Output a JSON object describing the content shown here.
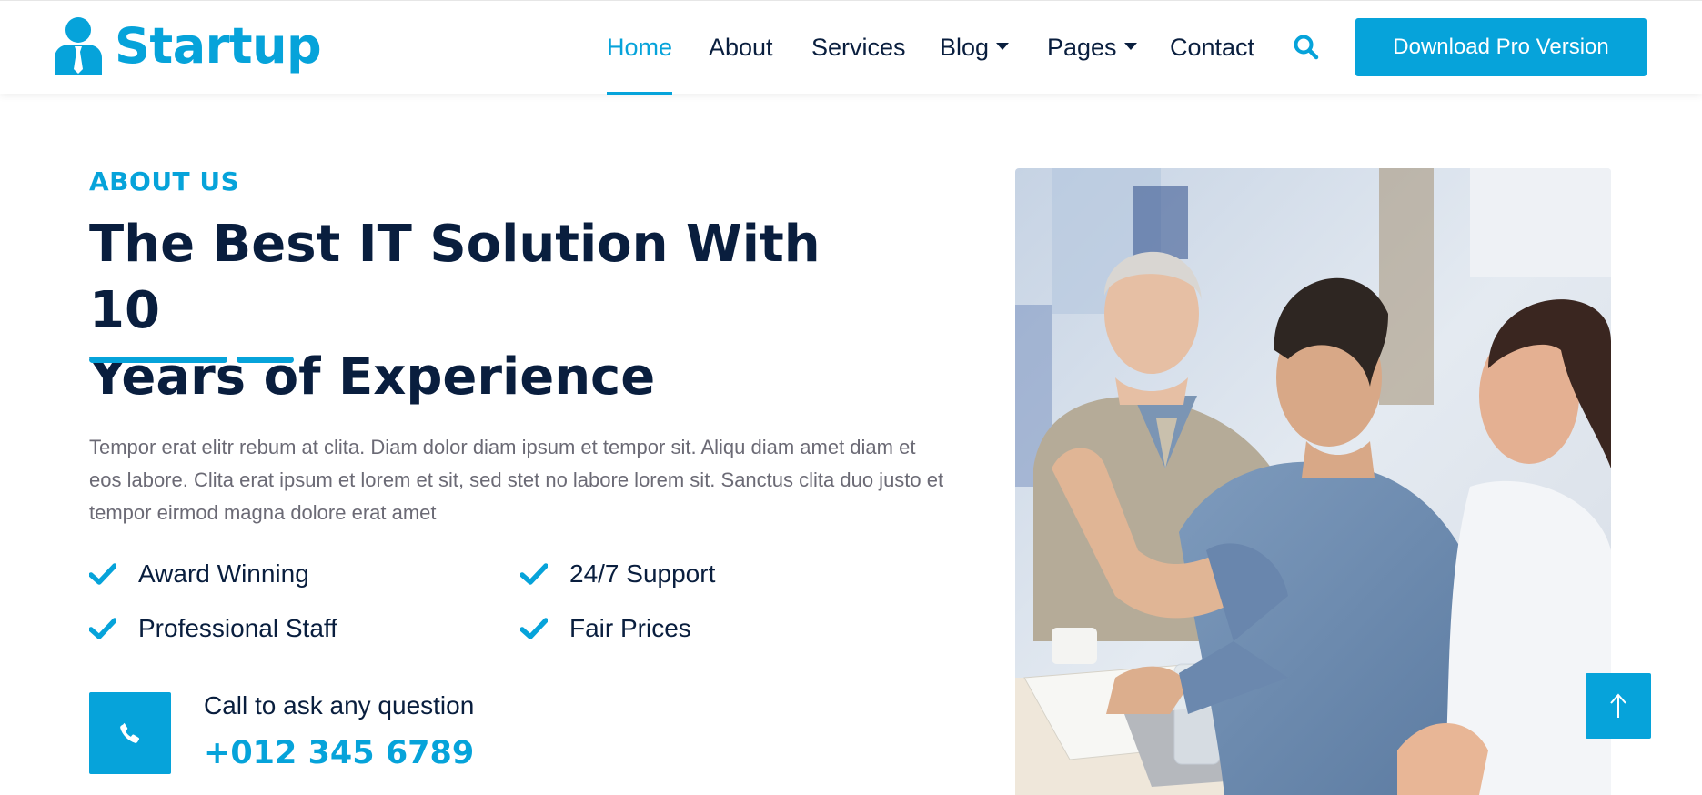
{
  "brand": {
    "name": "Startup",
    "icon": "user-tie-icon"
  },
  "nav": {
    "items": [
      {
        "label": "Home",
        "active": true
      },
      {
        "label": "About",
        "active": false
      },
      {
        "label": "Services",
        "active": false
      },
      {
        "label": "Blog",
        "active": false,
        "dropdown": true
      },
      {
        "label": "Pages",
        "active": false,
        "dropdown": true
      },
      {
        "label": "Contact",
        "active": false
      }
    ],
    "search_icon": "search-icon",
    "cta_label": "Download Pro Version"
  },
  "about": {
    "eyebrow": "ABOUT US",
    "headline_line1": "The Best IT Solution With 10",
    "headline_line2": "Years of Experience",
    "body": "Tempor erat elitr rebum at clita. Diam dolor diam ipsum et tempor sit. Aliqu diam amet diam et eos labore. Clita erat ipsum et lorem et sit, sed stet no labore lorem sit. Sanctus clita duo justo et tempor eirmod magna dolore erat amet",
    "features": [
      "Award Winning",
      "24/7 Support",
      "Professional Staff",
      "Fair Prices"
    ],
    "call_label": "Call to ask any question",
    "call_number": "+012 345 6789"
  },
  "colors": {
    "primary": "#06a3da",
    "dark": "#091e3e",
    "muted": "#6b6a75"
  },
  "back_to_top_icon": "arrow-up-icon"
}
